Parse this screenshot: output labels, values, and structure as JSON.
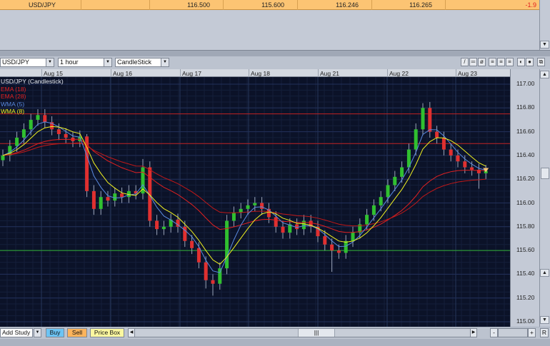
{
  "quote_row": {
    "symbol": "USD/JPY",
    "col1": "",
    "col2": "116.500",
    "col3": "115.600",
    "col4": "116.246",
    "col5": "116.265",
    "change": "-1.9"
  },
  "toolbar": {
    "symbol": "USD/JPY",
    "interval": "1 hour",
    "chart_type": "CandleStick"
  },
  "dates": [
    "Aug 15",
    "Aug 16",
    "Aug 17",
    "Aug 18",
    "Aug 21",
    "Aug 22",
    "Aug 23"
  ],
  "legend": [
    {
      "label": "USD/JPY (Candlestick)",
      "color": "#e8ecf4"
    },
    {
      "label": "EMA (18)",
      "color": "#e02020"
    },
    {
      "label": "EMA (28)",
      "color": "#e02020"
    },
    {
      "label": "WMA (5)",
      "color": "#5a8ae0"
    },
    {
      "label": "WMA (8)",
      "color": "#f0f020"
    }
  ],
  "bottom": {
    "add_study": "Add Study",
    "buy": "Buy",
    "sell": "Sell",
    "price_box": "Price Box",
    "zoom_out": "-",
    "zoom_in": "+",
    "reset": "R"
  },
  "colors": {
    "up": "#30c030",
    "down": "#e03030",
    "grid": "#1c2a4a",
    "bg": "#0b1228"
  },
  "chart_data": {
    "type": "candlestick",
    "ylim": [
      115.0,
      117.0
    ],
    "y_ticks": [
      "117.00",
      "116.80",
      "116.60",
      "116.40",
      "116.20",
      "116.00",
      "115.80",
      "115.60",
      "115.40",
      "115.20",
      "115.00"
    ],
    "horizontal_lines": [
      {
        "price": 116.75,
        "color": "#c02020"
      },
      {
        "price": 116.5,
        "color": "#c02020"
      },
      {
        "price": 115.6,
        "color": "#30b030"
      }
    ],
    "close": [
      116.4,
      116.48,
      116.55,
      116.62,
      116.7,
      116.74,
      116.68,
      116.62,
      116.58,
      116.55,
      116.52,
      116.56,
      116.1,
      115.95,
      116.05,
      116.02,
      116.08,
      116.05,
      116.1,
      116.08,
      116.3,
      115.85,
      115.78,
      115.8,
      115.86,
      115.8,
      115.68,
      115.62,
      115.5,
      115.35,
      115.32,
      115.45,
      115.85,
      115.92,
      115.95,
      115.98,
      116.0,
      115.95,
      115.88,
      115.8,
      115.75,
      115.82,
      115.78,
      115.85,
      115.8,
      115.72,
      115.65,
      115.6,
      115.58,
      115.68,
      115.75,
      115.82,
      115.9,
      115.98,
      116.05,
      116.15,
      116.22,
      116.3,
      116.45,
      116.62,
      116.8,
      116.6,
      116.55,
      116.45,
      116.4,
      116.35,
      116.3,
      116.28,
      116.25,
      116.27
    ],
    "wick_pad": 0.05,
    "high_overrides": {
      "20": 116.37,
      "60": 116.84,
      "12": 116.58
    },
    "low_overrides": {
      "30": 115.22,
      "29": 115.28,
      "47": 115.42,
      "68": 116.12
    },
    "studies": [
      {
        "name": "EMA",
        "period": 18,
        "color": "#e02020"
      },
      {
        "name": "EMA",
        "period": 28,
        "color": "#c01818"
      },
      {
        "name": "WMA",
        "period": 5,
        "color": "#5a8ae0"
      },
      {
        "name": "WMA",
        "period": 8,
        "color": "#f0f020"
      }
    ]
  }
}
